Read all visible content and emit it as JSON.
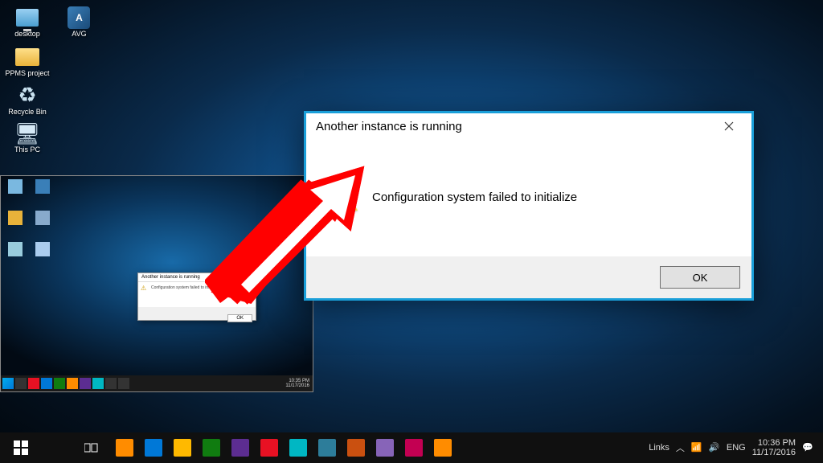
{
  "desktop_icons": [
    {
      "label": "desktop",
      "icon": "desktop"
    },
    {
      "label": "AVG",
      "icon": "avg"
    },
    {
      "label": "PPMS project",
      "icon": "folder"
    },
    {
      "label": "Recycle Bin",
      "icon": "recycle"
    },
    {
      "label": "This PC",
      "icon": "pc"
    }
  ],
  "dialog": {
    "title": "Another instance is running",
    "message": "Configuration system failed to initialize",
    "ok_label": "OK"
  },
  "mini_dialog": {
    "title": "Another instance is running",
    "message": "Configuration system failed to initialize",
    "ok_label": "OK"
  },
  "inner_taskbar": {
    "time": "10:35 PM",
    "date": "11/17/2016"
  },
  "taskbar": {
    "tray": {
      "links_label": "Links",
      "lang": "ENG",
      "time": "10:36 PM",
      "date": "11/17/2016"
    },
    "pinned_colors": [
      "#ff8c00",
      "#e81123",
      "#0078d7",
      "#107c10",
      "#5c2d91",
      "#ffb900",
      "#00b7c3",
      "#e3008c",
      "#2d7d9a",
      "#ca5010",
      "#8764b8",
      "#c30052"
    ]
  }
}
